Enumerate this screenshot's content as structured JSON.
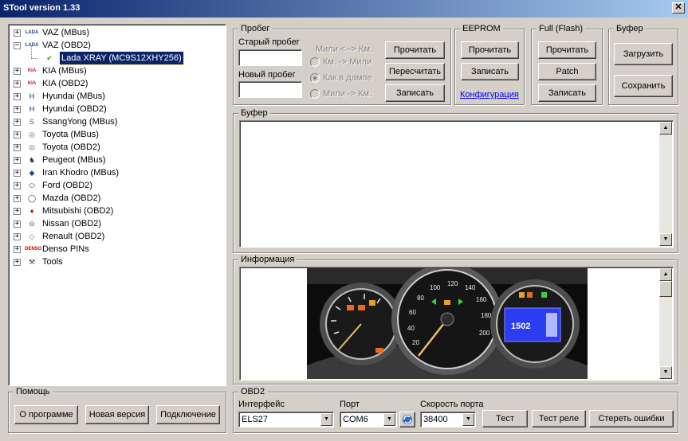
{
  "window": {
    "title": "STool version 1.33",
    "close": "✕"
  },
  "tree": {
    "items": [
      {
        "label": "VAZ (MBus)",
        "icon": "lada-logo-icon",
        "expander": "+"
      },
      {
        "label": "VAZ (OBD2)",
        "icon": "lada-logo-icon",
        "expander": "−"
      },
      {
        "label": "Lada XRAY (MC9S12XHY256)",
        "icon": "checkmark-icon",
        "child": true,
        "selected": true
      },
      {
        "label": "KIA (MBus)",
        "icon": "kia-logo-icon",
        "expander": "+"
      },
      {
        "label": "KIA (OBD2)",
        "icon": "kia-logo-icon",
        "expander": "+"
      },
      {
        "label": "Hyundai (MBus)",
        "icon": "hyundai-logo-icon",
        "expander": "+"
      },
      {
        "label": "Hyundai (OBD2)",
        "icon": "hyundai-logo-icon",
        "expander": "+"
      },
      {
        "label": "SsangYong (MBus)",
        "icon": "ssangyong-logo-icon",
        "expander": "+"
      },
      {
        "label": "Toyota (MBus)",
        "icon": "toyota-logo-icon",
        "expander": "+"
      },
      {
        "label": "Toyota (OBD2)",
        "icon": "toyota-logo-icon",
        "expander": "+"
      },
      {
        "label": "Peugeot (MBus)",
        "icon": "peugeot-logo-icon",
        "expander": "+"
      },
      {
        "label": "Iran Khodro (MBus)",
        "icon": "iran-khodro-logo-icon",
        "expander": "+"
      },
      {
        "label": "Ford (OBD2)",
        "icon": "ford-logo-icon",
        "expander": "+"
      },
      {
        "label": "Mazda (OBD2)",
        "icon": "mazda-logo-icon",
        "expander": "+"
      },
      {
        "label": "Mitsubishi (OBD2)",
        "icon": "mitsubishi-logo-icon",
        "expander": "+"
      },
      {
        "label": "Nissan (OBD2)",
        "icon": "nissan-logo-icon",
        "expander": "+"
      },
      {
        "label": "Renault (OBD2)",
        "icon": "renault-logo-icon",
        "expander": "+"
      },
      {
        "label": "Denso PINs",
        "icon": "denso-logo-icon",
        "expander": "+"
      },
      {
        "label": "Tools",
        "icon": "tools-icon",
        "expander": "+"
      }
    ]
  },
  "mileage": {
    "title": "Пробег",
    "old_label": "Старый пробег",
    "old_value": "",
    "new_label": "Новый пробег",
    "new_value": "",
    "conv_label": "Мили <--> Км.",
    "options": [
      "Км. -> Мили",
      "Как в дампе",
      "Мили -> Км."
    ],
    "read": "Прочитать",
    "recalc": "Пересчитать",
    "write": "Записать"
  },
  "eeprom": {
    "title": "EEPROM",
    "read": "Прочитать",
    "write": "Записать",
    "config": "Конфигурация"
  },
  "flash": {
    "title": "Full (Flash)",
    "read": "Прочитать",
    "patch": "Patch",
    "write": "Записать"
  },
  "buffer_group": {
    "title": "Буфер",
    "load": "Загрузить",
    "save": "Сохранить"
  },
  "buffer_panel": {
    "title": "Буфер",
    "content": ""
  },
  "info_panel": {
    "title": "Информация",
    "lcd_text": "1502"
  },
  "help": {
    "title": "Помощь",
    "about": "О программе",
    "update": "Новая версия",
    "connect": "Подключение"
  },
  "obd2": {
    "title": "OBD2",
    "interface_label": "Интерфейс",
    "interface_value": "ELS27",
    "port_label": "Порт",
    "port_value": "COM6",
    "speed_label": "Скорость порта",
    "speed_value": "38400",
    "test": "Тест",
    "test_relay": "Тест реле",
    "clear_errors": "Стереть ошибки"
  },
  "icons": {
    "expander": "+",
    "scroll_up": "▲",
    "scroll_down": "▼",
    "combo": "▼",
    "refresh": "refresh-icon"
  },
  "colors": {
    "selection": "#0a246a",
    "title_start": "#0a246a",
    "title_end": "#a6caf0",
    "link": "#0000ff"
  }
}
